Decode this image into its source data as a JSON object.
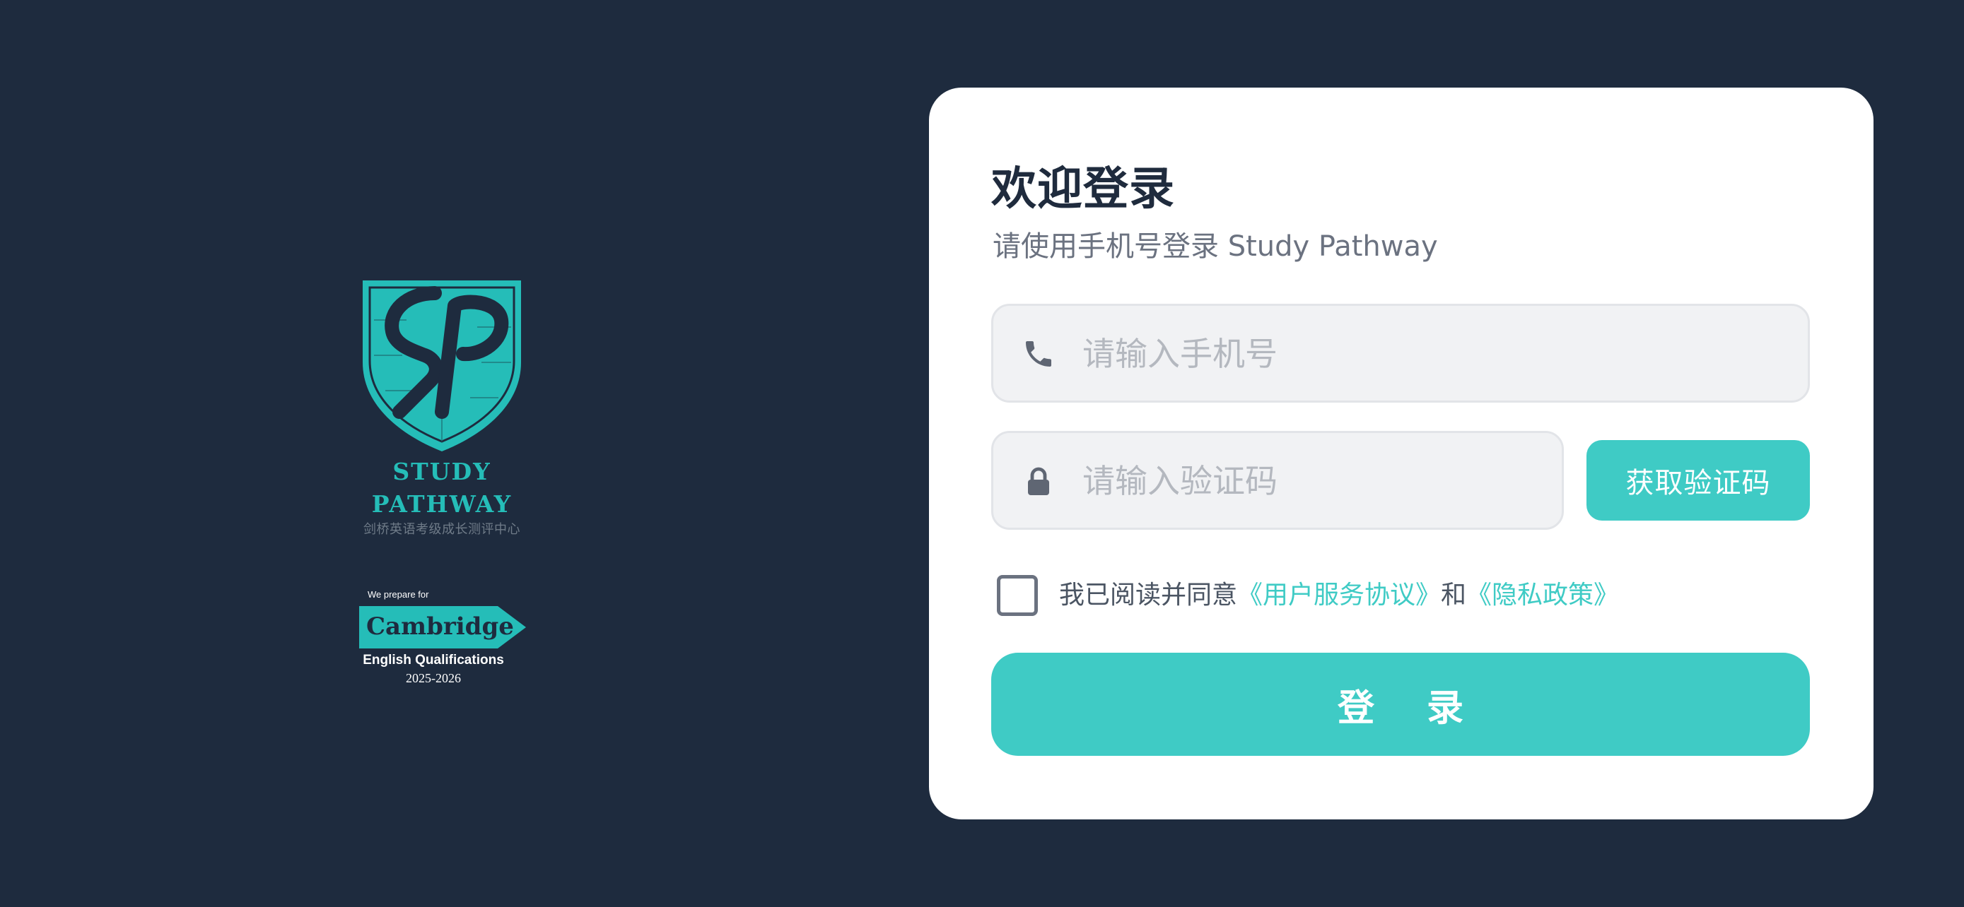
{
  "brand": {
    "name_line1": "STUDY",
    "name_line2": "PATHWAY",
    "tagline": "剑桥英语考级成长测评中心",
    "cambridge": {
      "prepare_text": "We prepare for",
      "wordmark": "Cambridge",
      "qualifications": "English Qualifications",
      "years": "2025-2026"
    }
  },
  "login": {
    "title": "欢迎登录",
    "subtitle": "请使用手机号登录 Study Pathway",
    "phone_placeholder": "请输入手机号",
    "code_placeholder": "请输入验证码",
    "get_code_label": "获取验证码",
    "agree_prefix": "我已阅读并同意",
    "terms_link": "《用户服务协议》",
    "agree_and": "和",
    "privacy_link": "《隐私政策》",
    "submit_label": "登 录"
  },
  "colors": {
    "background": "#1e2b3e",
    "accent": "#3fcbc5",
    "card": "#ffffff"
  },
  "icons": [
    "phone-icon",
    "lock-icon"
  ]
}
